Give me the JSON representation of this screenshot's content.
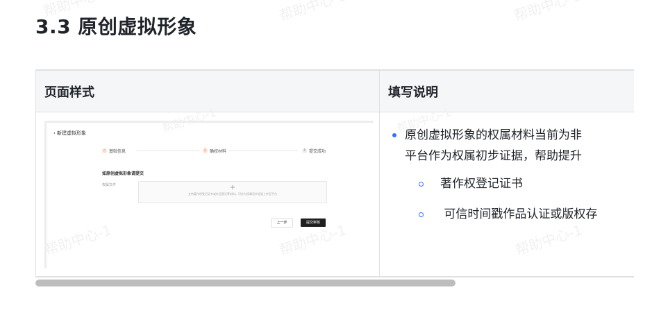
{
  "watermark_text": "帮助中心-1",
  "heading": "3.3 原创虚拟形象",
  "table": {
    "headers": [
      "页面样式",
      "填写说明"
    ],
    "notes": {
      "main_line1": "原创虚拟形象的权属材料当前为非",
      "main_line2": "平台作为权属初步证据，帮助提升",
      "sub_items": [
        "著作权登记证书",
        " 可信时间戳作品认证或版权存"
      ]
    }
  },
  "preview": {
    "back_label": "‹ 新建虚拟形象",
    "steps": [
      {
        "num": "✓",
        "label": "基础信息",
        "state": "done"
      },
      {
        "num": "2",
        "label": "确权材料",
        "state": "active"
      },
      {
        "num": "3",
        "label": "提交成功",
        "state": "todo"
      }
    ],
    "section_title": "如原创虚拟形象请提交",
    "field_label": "权属文件",
    "upload_plus": "+",
    "upload_hint": "支持著作权登记证书或作品登记等材料，可作为权属初步证据上传至平台",
    "prev_button": "上一步",
    "submit_button": "提交审核"
  },
  "colors": {
    "accent": "#3370ff",
    "step_accent": "#f17b36",
    "header_bg": "#f5f6f7",
    "border": "#dee0e3"
  }
}
